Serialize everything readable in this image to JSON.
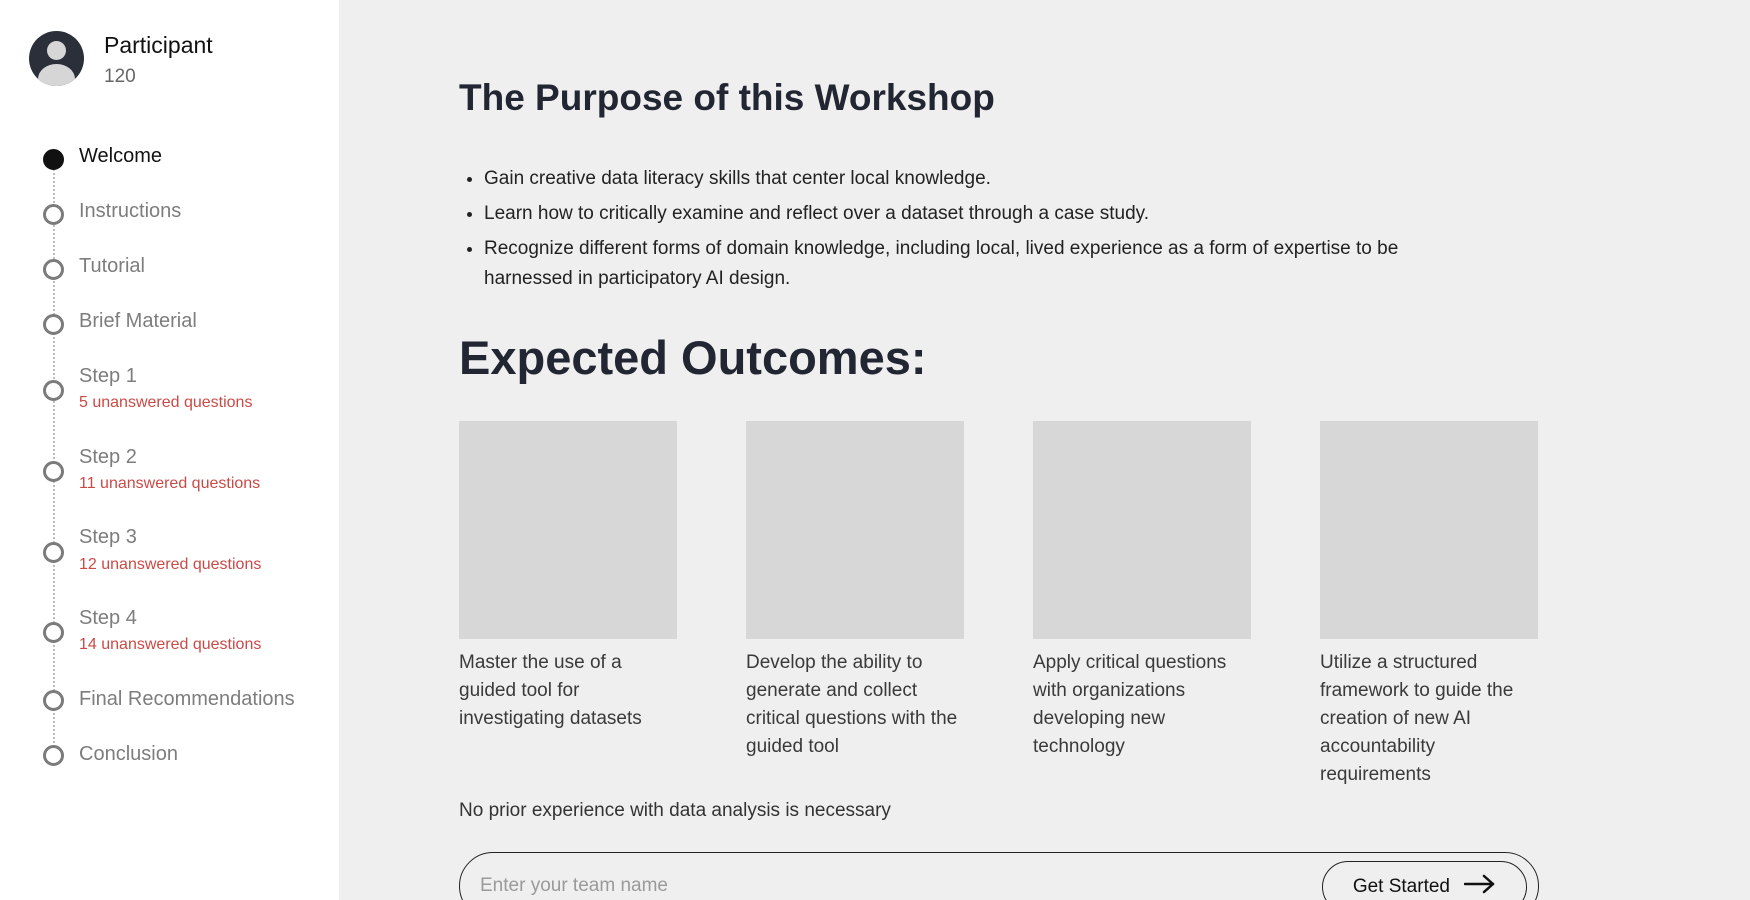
{
  "user": {
    "name": "Participant",
    "id": "120"
  },
  "steps": [
    {
      "label": "Welcome",
      "sub": "",
      "active": true
    },
    {
      "label": "Instructions",
      "sub": ""
    },
    {
      "label": "Tutorial",
      "sub": ""
    },
    {
      "label": "Brief Material",
      "sub": ""
    },
    {
      "label": "Step 1",
      "sub": "5 unanswered questions"
    },
    {
      "label": "Step 2",
      "sub": "11 unanswered questions"
    },
    {
      "label": "Step 3",
      "sub": "12 unanswered questions"
    },
    {
      "label": "Step 4",
      "sub": "14 unanswered questions"
    },
    {
      "label": "Final Recommendations",
      "sub": ""
    },
    {
      "label": "Conclusion",
      "sub": ""
    }
  ],
  "main": {
    "purpose_title": "The Purpose of this Workshop",
    "goals": [
      "Gain creative data literacy skills that center local knowledge.",
      "Learn how to critically examine and reflect over a dataset through a case study.",
      "Recognize different forms of domain knowledge, including local, lived experience as a form of expertise to be harnessed in participatory AI design."
    ],
    "outcomes_title": "Expected Outcomes:",
    "outcomes": [
      "Master the use of a guided tool for investigating datasets",
      "Develop the ability to generate and collect critical questions with the guided tool",
      "Apply critical questions with organizations developing new technology",
      "Utilize a structured framework to guide the creation of new AI accountability requirements"
    ],
    "note": "No prior experience with data analysis is necessary",
    "team_input_placeholder": "Enter your team name",
    "get_started_label": "Get Started"
  },
  "colors": {
    "warning": "#c94a46",
    "sidebar_bg": "#ffffff",
    "main_bg": "#efefef"
  },
  "icons": {
    "avatar": "user-avatar-icon",
    "arrow": "arrow-right-icon"
  }
}
